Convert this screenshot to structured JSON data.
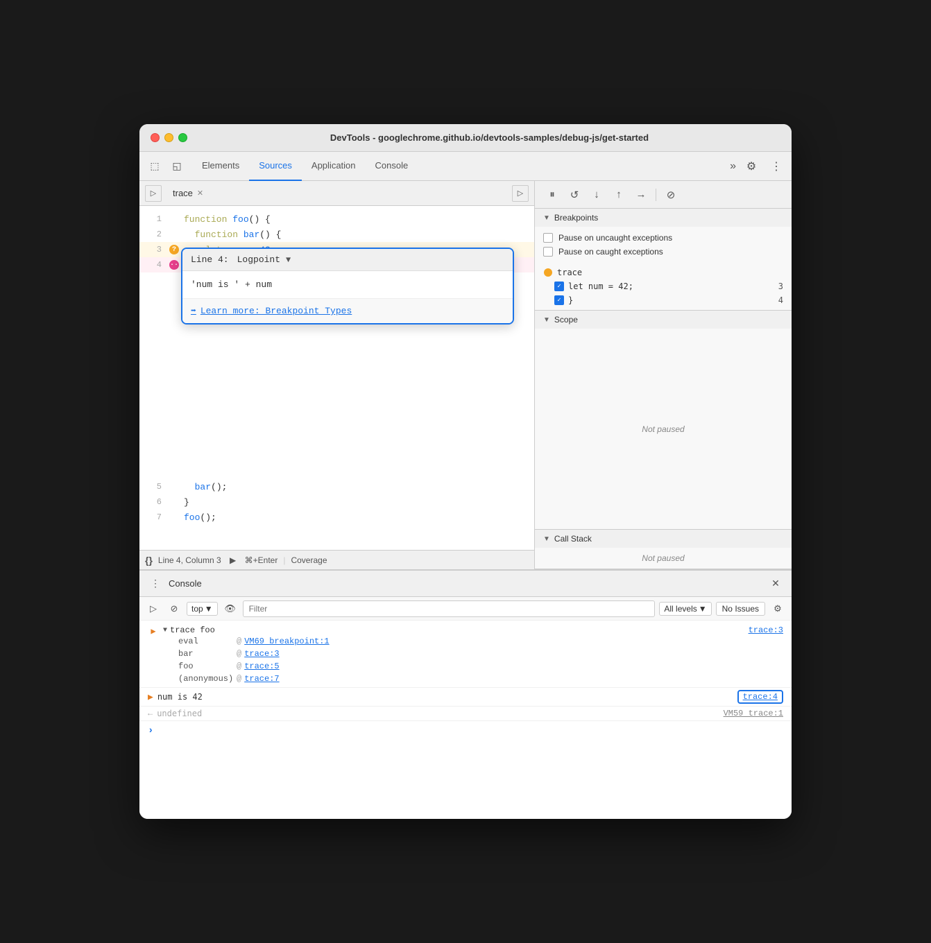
{
  "titlebar": {
    "title": "DevTools - googlechrome.github.io/devtools-samples/debug-js/get-started"
  },
  "nav": {
    "tabs": [
      {
        "label": "Elements",
        "active": false
      },
      {
        "label": "Sources",
        "active": true
      },
      {
        "label": "Application",
        "active": false
      },
      {
        "label": "Console",
        "active": false
      }
    ],
    "more_icon": "≫",
    "gear_icon": "⚙",
    "dots_icon": "⋮"
  },
  "sources": {
    "file_tab": "trace",
    "code_lines": [
      {
        "num": "1",
        "content": "function foo() {",
        "has_breakpoint": false
      },
      {
        "num": "2",
        "content": "  function bar() {",
        "has_breakpoint": false
      },
      {
        "num": "3",
        "content": "    let num = 42;",
        "has_breakpoint": true,
        "bp_type": "orange"
      },
      {
        "num": "4",
        "content": "  }",
        "has_breakpoint": true,
        "bp_type": "pink"
      },
      {
        "num": "5",
        "content": "  bar();",
        "has_breakpoint": false
      },
      {
        "num": "6",
        "content": "}",
        "has_breakpoint": false
      },
      {
        "num": "7",
        "content": "foo();",
        "has_breakpoint": false
      }
    ],
    "logpoint": {
      "header_line": "Line 4:",
      "type": "Logpoint",
      "input_value": "'num is ' + num",
      "link_text": "Learn more: Breakpoint Types"
    },
    "status_bar": {
      "line_col": "Line 4, Column 3",
      "run_label": "⌘+Enter",
      "coverage": "Coverage"
    }
  },
  "debugger": {
    "breakpoints_section": "Breakpoints",
    "pause_uncaught": "Pause on uncaught exceptions",
    "pause_caught": "Pause on caught exceptions",
    "breakpoint_file": "trace",
    "bp_items": [
      {
        "text": "let num = 42;",
        "line": "3"
      },
      {
        "text": "}",
        "line": "4"
      }
    ],
    "scope_section": "Scope",
    "scope_status": "Not paused",
    "callstack_section": "Call Stack",
    "callstack_status": "Not paused"
  },
  "console": {
    "title": "Console",
    "close_icon": "✕",
    "toolbar": {
      "top_label": "top",
      "filter_placeholder": "Filter",
      "all_levels": "All levels",
      "no_issues": "No Issues"
    },
    "entries": [
      {
        "type": "trace_group",
        "group_label": "▶ trace foo",
        "ref": "trace:3",
        "stack": [
          {
            "label": "eval",
            "at": "@",
            "link": "VM69 breakpoint:1"
          },
          {
            "label": "bar",
            "at": "@",
            "link": "trace:3"
          },
          {
            "label": "foo",
            "at": "@",
            "link": "trace:5"
          },
          {
            "label": "(anonymous)",
            "at": "@",
            "link": "trace:7"
          }
        ]
      },
      {
        "type": "result",
        "text": "num is 42",
        "ref": "trace:4"
      },
      {
        "type": "undefined",
        "text": "undefined",
        "vm_ref": "VM59 trace:1"
      }
    ],
    "prompt_symbol": ">"
  }
}
